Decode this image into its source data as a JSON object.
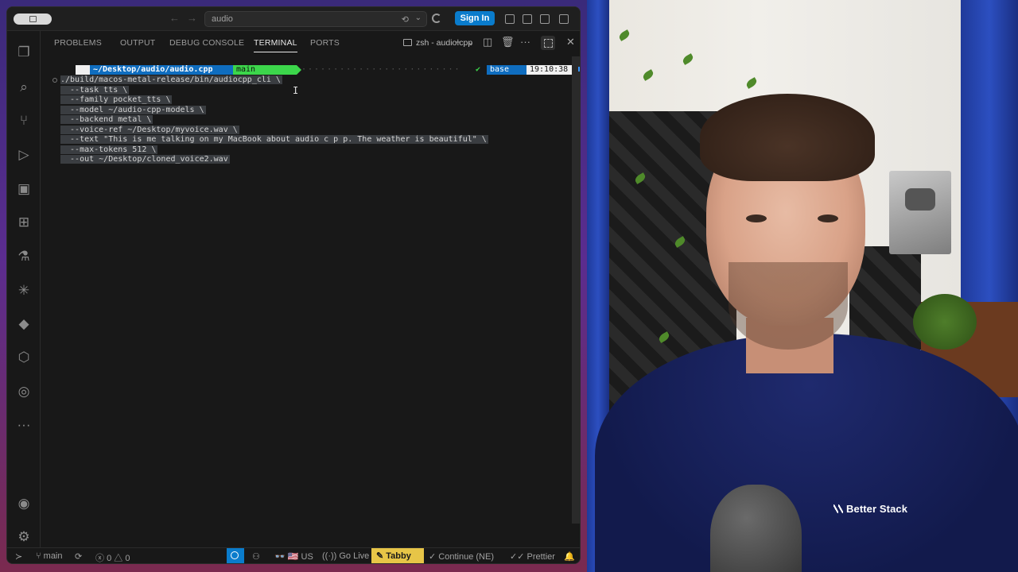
{
  "titlebar": {
    "search_label": "audio",
    "sign_in": "Sign In"
  },
  "panel": {
    "tabs": [
      "PROBLEMS",
      "OUTPUT",
      "DEBUG CONSOLE",
      "TERMINAL",
      "PORTS"
    ],
    "active_tab": "TERMINAL",
    "terminal_name": "zsh - audio.cpp"
  },
  "terminal": {
    "prompt": {
      "path": "~/Desktop/audio/audio.cpp",
      "branch": "main",
      "env": "base",
      "time": "19:10:38"
    },
    "lines": [
      "./build/macos-metal-release/bin/audiocpp_cli \\",
      "  --task tts \\",
      "  --family pocket_tts \\",
      "  --model ~/audio-cpp-models \\",
      "  --backend metal \\",
      "  --voice-ref ~/Desktop/myvoice.wav \\",
      "  --text \"This is me talking on my MacBook about audio c p p. The weather is beautiful\" \\",
      "  --max-tokens 512 \\",
      "  --out ~/Desktop/cloned_voice2.wav"
    ]
  },
  "statusbar": {
    "branch": "main",
    "errors": "0",
    "warnings": "0",
    "keyboard": "US",
    "go_live": "Go Live",
    "tabby": "Tabby",
    "continue": "Continue (NE)",
    "prettier": "Prettier"
  },
  "webcam": {
    "brand": "Better Stack"
  },
  "colors": {
    "accent_blue": "#0a7ccc",
    "git_green": "#3cd64b",
    "tabby_yellow": "#e7c547"
  },
  "icons": [
    "explorer-icon",
    "search-icon",
    "source-control-icon",
    "run-debug-icon",
    "remote-explorer-icon",
    "extensions-icon",
    "testing-icon",
    "copilot-icon",
    "python-icon",
    "containers-icon",
    "gitlens-icon",
    "more-icon",
    "account-icon",
    "settings-icon"
  ]
}
